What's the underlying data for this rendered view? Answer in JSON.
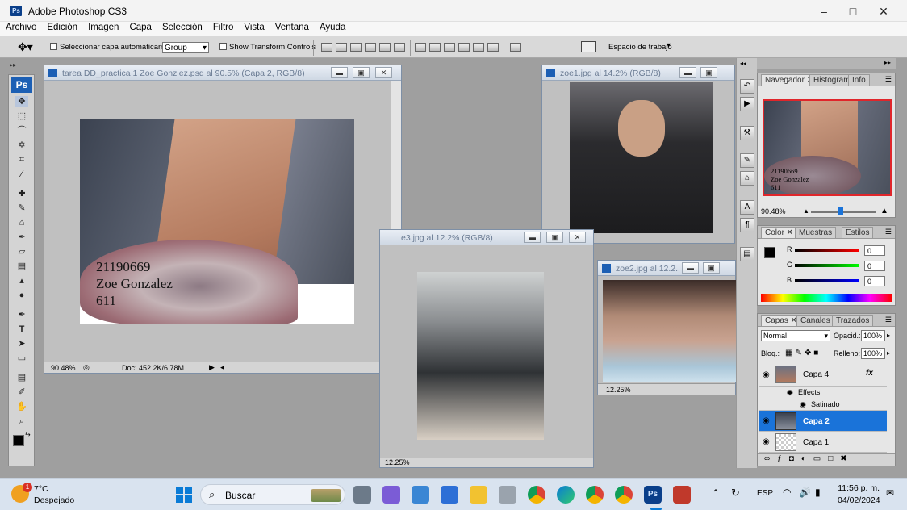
{
  "app": {
    "title": "Adobe Photoshop CS3",
    "logo": "Ps"
  },
  "menu": [
    "Archivo",
    "Edición",
    "Imagen",
    "Capa",
    "Selección",
    "Filtro",
    "Vista",
    "Ventana",
    "Ayuda"
  ],
  "options": {
    "auto_select_label": "Seleccionar capa automáticamente",
    "auto_select_value": "Group",
    "transform_label": "Show Transform Controls",
    "workspace_label": "Espacio de trabajo"
  },
  "toolbox": {
    "logo": "Ps"
  },
  "documents": [
    {
      "title": "tarea DD_practica 1 Zoe Gonzlez.psd al 90.5% (Capa 2, RGB/8)",
      "zoom": "90.48%",
      "doc_info": "Doc: 452.2K/6.78M",
      "overlay_lines": [
        "21190669",
        "Zoe Gonzalez",
        "611"
      ]
    },
    {
      "title": "zoe1.jpg al 14.2% (RGB/8)"
    },
    {
      "title": "e3.jpg al 12.2% (RGB/8)",
      "zoom": "12.25%"
    },
    {
      "title": "zoe2.jpg al 12.2...",
      "zoom": "12.25%"
    }
  ],
  "navigator": {
    "tabs": [
      "Navegador",
      "Histograma",
      "Info"
    ],
    "zoom": "90.48%",
    "preview_lines": [
      "21190669",
      "Zoe Gonzalez",
      "611"
    ]
  },
  "color": {
    "tabs": [
      "Color",
      "Muestras",
      "Estilos"
    ],
    "channels": [
      {
        "name": "R",
        "value": "0"
      },
      {
        "name": "G",
        "value": "0"
      },
      {
        "name": "B",
        "value": "0"
      }
    ],
    "foreground": "#000000",
    "background": "#ffffff"
  },
  "layers": {
    "tabs": [
      "Capas",
      "Canales",
      "Trazados"
    ],
    "blend_mode": "Normal",
    "opacity_label": "Opacid.:",
    "opacity": "100%",
    "lock_label": "Bloq.:",
    "fill_label": "Relleno:",
    "fill": "100%",
    "items": [
      {
        "name": "Capa 4",
        "fx": "fx"
      },
      {
        "name": "Effects"
      },
      {
        "name": "Satinado"
      },
      {
        "name": "Capa 2",
        "selected": true
      },
      {
        "name": "Capa 1"
      }
    ]
  },
  "taskbar": {
    "weather_temp": "7°C",
    "weather_desc": "Despejado",
    "weather_badge": "1",
    "search_label": "Buscar",
    "language": "ESP",
    "time": "11:56 p. m.",
    "date": "04/02/2024"
  },
  "colors": {
    "accent": "#0a7bd6",
    "ps_blue": "#1c5fb4",
    "selected_layer": "#1a73d9"
  }
}
